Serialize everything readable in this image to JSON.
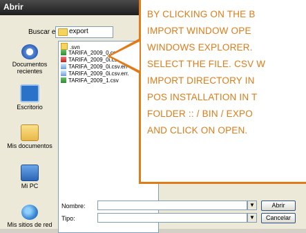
{
  "window": {
    "title": "Abrir"
  },
  "lookin": {
    "label": "Buscar en:",
    "value": "export"
  },
  "places": [
    {
      "label": "Documentos recientes",
      "icon": "recent-documents-icon"
    },
    {
      "label": "Escritorio",
      "icon": "desktop-icon"
    },
    {
      "label": "Mis documentos",
      "icon": "my-documents-icon"
    },
    {
      "label": "Mi PC",
      "icon": "my-computer-icon"
    },
    {
      "label": "Mis sitios de red",
      "icon": "network-places-icon"
    }
  ],
  "files": [
    {
      "name": ".svn",
      "type": "folder"
    },
    {
      "name": "TARIFA_2009_0.csv",
      "type": "csv"
    },
    {
      "name": "TARIFA_2009_0i.csv",
      "type": "csv-red"
    },
    {
      "name": "TARIFA_2009_0i.csv.err",
      "type": "err"
    },
    {
      "name": "TARIFA_2009_0i.csv.err.",
      "type": "err"
    },
    {
      "name": "TARIFA_2009_1.csv",
      "type": "csv"
    }
  ],
  "bottom": {
    "name_label": "Nombre:",
    "type_label": "Tipo:",
    "open_button": "Abrir",
    "cancel_button": "Cancelar"
  },
  "callout": {
    "lines": [
      "BY CLICKING ON THE B",
      "IMPORT WINDOW OPE",
      "WINDOWS EXPLORER.",
      "SELECT THE FILE. CSV W",
      "IMPORT DIRECTORY IN",
      "POS INSTALLATION IN T",
      "FOLDER :: / BIN / EXPO",
      "AND CLICK ON OPEN."
    ]
  }
}
